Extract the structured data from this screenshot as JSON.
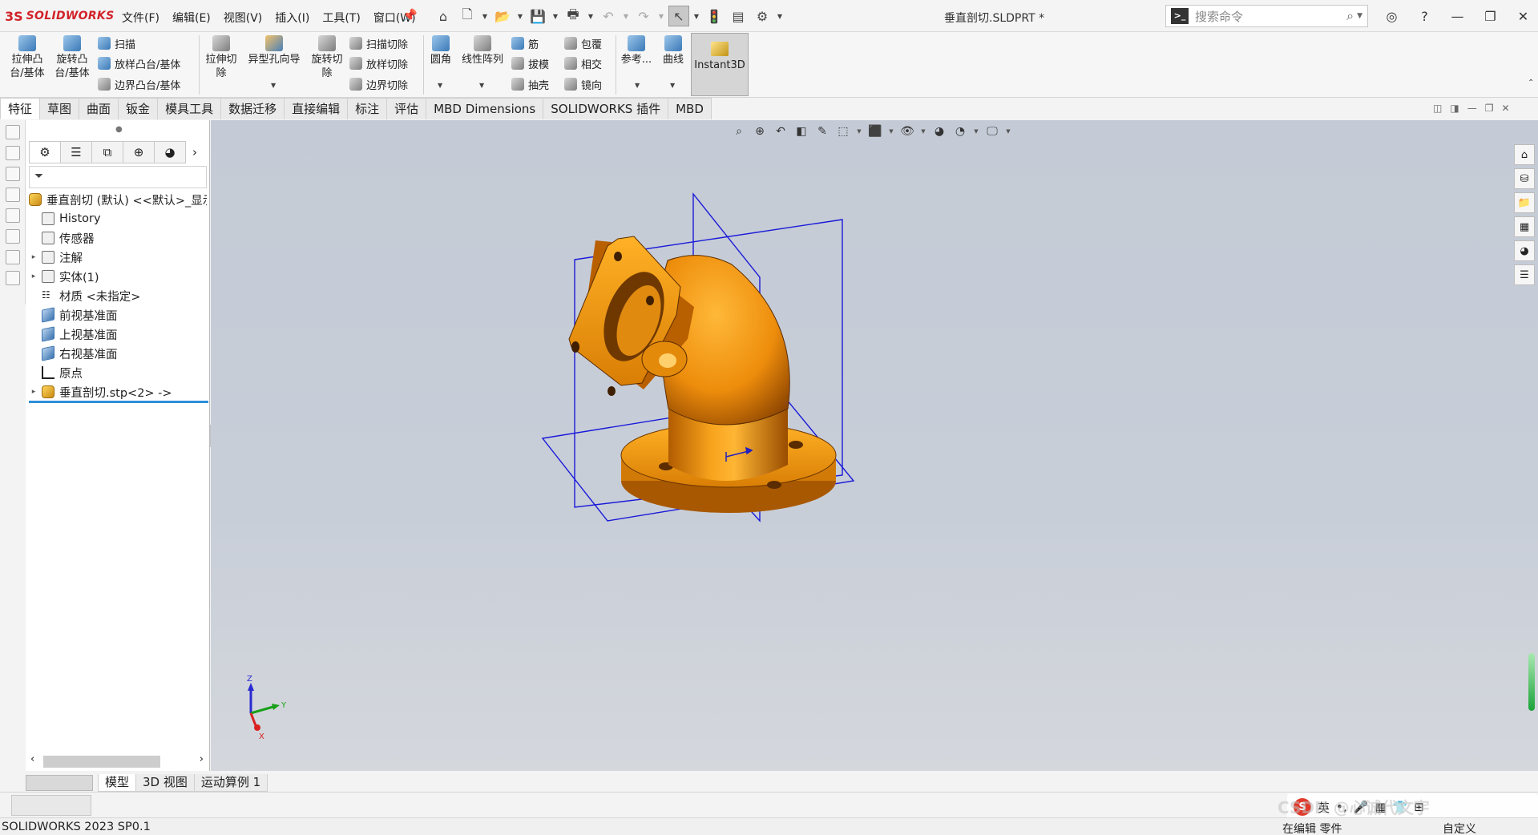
{
  "app": {
    "brand": "SOLIDWORKS",
    "document_title": "垂直剖切.SLDPRT *"
  },
  "menu": [
    "文件(F)",
    "编辑(E)",
    "视图(V)",
    "插入(I)",
    "工具(T)",
    "窗口(W)"
  ],
  "search": {
    "placeholder": "搜索命令"
  },
  "ribbon": {
    "extrude_boss": "拉伸凸\n台/基体",
    "revolve_boss": "旋转凸\n台/基体",
    "sweep": "扫描",
    "loft": "放样凸台/基体",
    "boundary": "边界凸台/基体",
    "extrude_cut": "拉伸切\n除",
    "hole_wizard": "异型孔向导",
    "revolve_cut": "旋转切\n除",
    "sweep_cut": "扫描切除",
    "loft_cut": "放样切除",
    "boundary_cut": "边界切除",
    "fillet": "圆角",
    "linear_pattern": "线性阵列",
    "rib": "筋",
    "draft": "拔模",
    "shell": "抽壳",
    "wrap": "包覆",
    "intersect": "相交",
    "mirror": "镜向",
    "reference": "参考...",
    "curves": "曲线",
    "instant3d": "Instant3D"
  },
  "tabs": [
    "特征",
    "草图",
    "曲面",
    "钣金",
    "模具工具",
    "数据迁移",
    "直接编辑",
    "标注",
    "评估",
    "MBD Dimensions",
    "SOLIDWORKS 插件",
    "MBD"
  ],
  "active_tab": "特征",
  "tree": {
    "root": "垂直剖切 (默认) <<默认>_显示",
    "items": [
      {
        "label": "History"
      },
      {
        "label": "传感器"
      },
      {
        "label": "注解"
      },
      {
        "label": "实体(1)"
      },
      {
        "label": "材质 <未指定>"
      },
      {
        "label": "前视基准面"
      },
      {
        "label": "上视基准面"
      },
      {
        "label": "右视基准面"
      },
      {
        "label": "原点"
      },
      {
        "label": "垂直剖切.stp<2> ->"
      }
    ]
  },
  "triad": {
    "z": "Z",
    "y": "Y",
    "x": "X"
  },
  "bottom_tabs": [
    "模型",
    "3D 视图",
    "运动算例 1"
  ],
  "status": {
    "version": "SOLIDWORKS 2023 SP0.1",
    "mode": "在编辑 零件",
    "custom": "自定义"
  },
  "ime": {
    "lang": "英",
    "watermark": "CSDN @心诚代文宇"
  },
  "colors": {
    "part": "#f0a020",
    "plane": "#1a1ad8",
    "brand": "#d2232a"
  }
}
